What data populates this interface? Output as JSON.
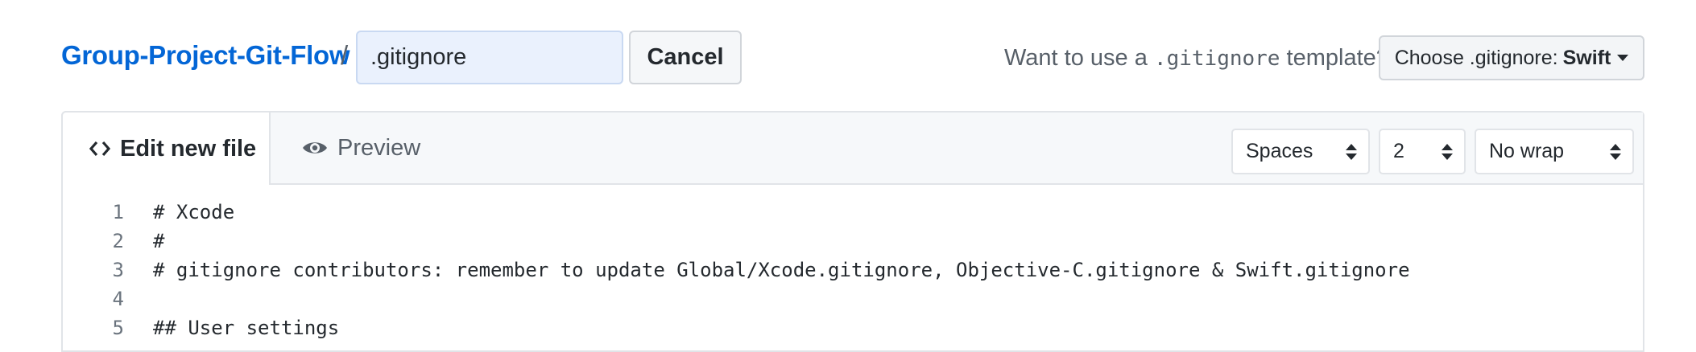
{
  "header": {
    "repo_name": "Group-Project-Git-Flow",
    "path_separator": "/",
    "filename_value": ".gitignore",
    "cancel_label": "Cancel",
    "template_prompt_before": "Want to use a ",
    "template_prompt_code": ".gitignore",
    "template_prompt_after": " template?",
    "template_button_prefix": "Choose .gitignore:",
    "template_button_selected": "Swift"
  },
  "editor": {
    "tabs": [
      {
        "label": "Edit new file",
        "icon": "code-icon",
        "active": true
      },
      {
        "label": "Preview",
        "icon": "eye-icon",
        "active": false
      }
    ],
    "indent_mode": "Spaces",
    "indent_size": "2",
    "wrap_mode": "No wrap",
    "lines": [
      {
        "no": "1",
        "text": "# Xcode"
      },
      {
        "no": "2",
        "text": "#"
      },
      {
        "no": "3",
        "text": "# gitignore contributors: remember to update Global/Xcode.gitignore, Objective-C.gitignore & Swift.gitignore"
      },
      {
        "no": "4",
        "text": ""
      },
      {
        "no": "5",
        "text": "## User settings"
      }
    ]
  },
  "colors": {
    "link": "#0366d6",
    "input_bg": "#eaf1fd",
    "header_bg": "#f6f8fa",
    "border": "#e1e4e8"
  }
}
